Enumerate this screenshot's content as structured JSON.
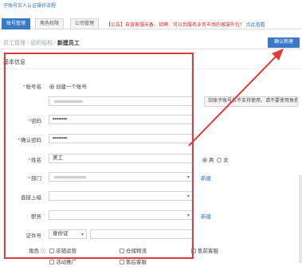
{
  "header": {
    "note": "子账号实人认证操作流程"
  },
  "tabs": [
    {
      "label": "账号管理",
      "active": true
    },
    {
      "label": "角色权限",
      "active": false
    },
    {
      "label": "公司管理",
      "active": false
    }
  ],
  "notice": {
    "text": "【公告】自营客服未备、招聘、可以到服务业务市场的客服外包！",
    "link": "点此查看"
  },
  "breadcrumb": {
    "root": "员工管理",
    "parent": "组织结构",
    "current": "新建员工"
  },
  "actions": {
    "confirm": "确认新建"
  },
  "form": {
    "section_title": "基本信息",
    "account": {
      "label": "账号名",
      "option": "创建一个账号",
      "tip": "旧账子账号名不支持使用，请不要使用角色"
    },
    "password": {
      "label": "密码",
      "value": "••••••••"
    },
    "confirm_password": {
      "label": "确认密码",
      "value": "••••••••"
    },
    "name": {
      "label": "姓名",
      "value": "美工"
    },
    "gender": {
      "male": "男",
      "female": "女",
      "selected": "男"
    },
    "department": {
      "label": "部门",
      "new_link": "新建"
    },
    "supervisor": {
      "label": "直接上级"
    },
    "position": {
      "label": "职务",
      "new_link": "新建"
    },
    "id_type": {
      "label": "证件号",
      "value": "身份证"
    },
    "roles": {
      "label": "角色",
      "options": [
        "店铺运营",
        "仓储物流",
        "售前客服",
        "活动推广",
        "售后客服"
      ]
    }
  },
  "colors": {
    "accent": "#3a78c8",
    "highlight": "#e23a3a",
    "notice": "#e0302a"
  }
}
